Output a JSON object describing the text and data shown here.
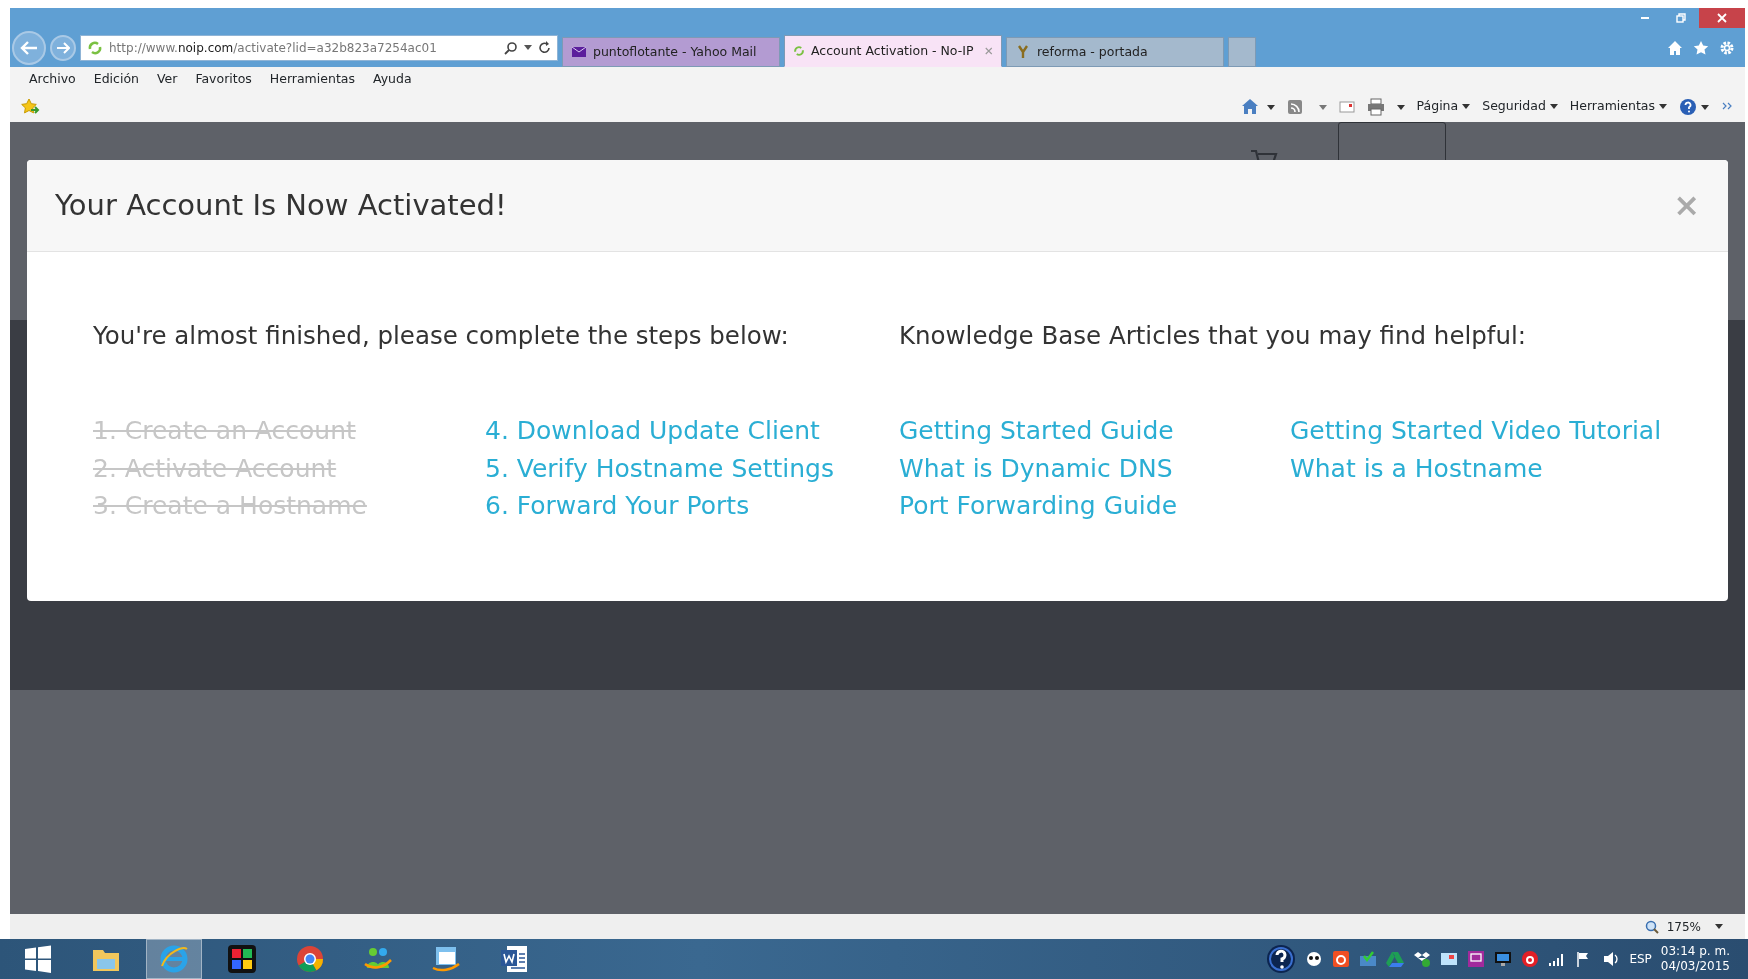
{
  "browser": {
    "address": {
      "prefix": "http://www.",
      "host": "noip.com",
      "path": "/activate?lid=a32b823a7254ac01"
    },
    "tabs": [
      {
        "title": "puntoflotante - Yahoo Mail",
        "selected": false,
        "color": "#b39bd2"
      },
      {
        "title": "Account Activation - No-IP",
        "selected": true,
        "color": "#f8e3f6"
      },
      {
        "title": "reforma - portada",
        "selected": false,
        "color": "#a4b9cd"
      }
    ],
    "menu": [
      "Archivo",
      "Edición",
      "Ver",
      "Favoritos",
      "Herramientas",
      "Ayuda"
    ],
    "command_bar": [
      "Página",
      "Seguridad",
      "Herramientas"
    ]
  },
  "modal": {
    "title": "Your Account Is Now Activated!",
    "close": "×",
    "steps_heading": "You're almost finished, please complete the steps below:",
    "steps": [
      [
        {
          "label": "1. Create an Account",
          "done": true
        },
        {
          "label": "2. Activate Account",
          "done": true
        },
        {
          "label": "3. Create a Hostname",
          "done": true
        }
      ],
      [
        {
          "label": "4. Download Update Client",
          "done": false
        },
        {
          "label": "5. Verify Hostname Settings",
          "done": false
        },
        {
          "label": "6. Forward Your Ports",
          "done": false
        }
      ]
    ],
    "articles_heading": "Knowledge Base Articles that you may find helpful:",
    "articles": [
      [
        "Getting Started Guide",
        "What is Dynamic DNS",
        "Port Forwarding Guide"
      ],
      [
        "Getting Started Video Tutorial",
        "What is a Hostname"
      ]
    ]
  },
  "status_bar": {
    "zoom": "175%"
  },
  "taskbar": {
    "language": "ESP",
    "time": "03:14 p. m.",
    "date": "04/03/2015"
  }
}
